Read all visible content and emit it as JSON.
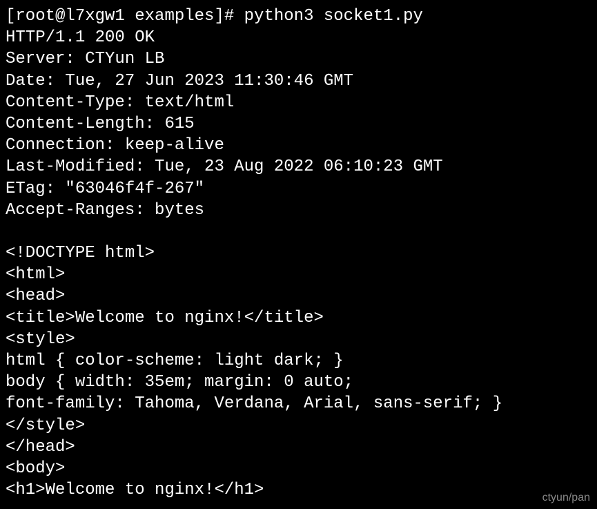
{
  "prompt": "[root@l7xgw1 examples]# ",
  "command": "python3 socket1.py",
  "response": {
    "status_line": "HTTP/1.1 200 OK",
    "headers": [
      "Server: CTYun LB",
      "Date: Tue, 27 Jun 2023 11:30:46 GMT",
      "Content-Type: text/html",
      "Content-Length: 615",
      "Connection: keep-alive",
      "Last-Modified: Tue, 23 Aug 2022 06:10:23 GMT",
      "ETag: \"63046f4f-267\"",
      "Accept-Ranges: bytes"
    ],
    "blank_line": "",
    "body_lines": [
      "<!DOCTYPE html>",
      "<html>",
      "<head>",
      "<title>Welcome to nginx!</title>",
      "<style>",
      "html { color-scheme: light dark; }",
      "body { width: 35em; margin: 0 auto;",
      "font-family: Tahoma, Verdana, Arial, sans-serif; }",
      "</style>",
      "</head>",
      "<body>",
      "<h1>Welcome to nginx!</h1>"
    ]
  },
  "watermark": "ctyun/pan"
}
